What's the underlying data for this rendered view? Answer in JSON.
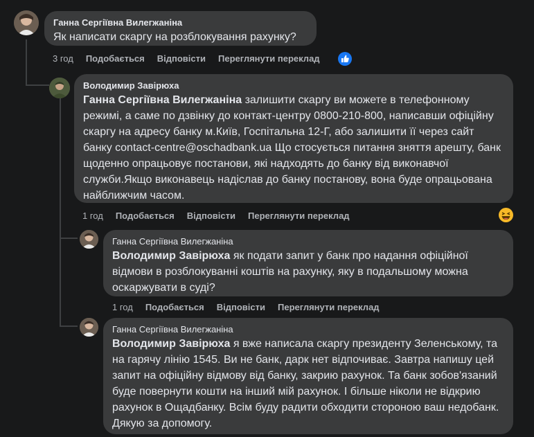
{
  "comments": [
    {
      "author": "Ганна Сергіївна Вилегжаніна",
      "mention": "",
      "text": "Як написати скаргу на розблокування рахунку?",
      "time": "3 год",
      "reaction_icon": "like-icon"
    },
    {
      "author": "Володимир Завірюха",
      "mention": "Ганна Сергіївна Вилегжаніна",
      "text": " залишити скаргу ви можете в телефонному режимі, а саме по дзвінку до контакт-центру 0800-210-800, написавши офіційну скаргу на адресу банку м.Київ, Госпітальна 12-Г, або залишити її через сайт банку contact-centre@oschadbank.ua Що стосується питання зняття арешту, банк щоденно опрацьовує постанови, які надходять до банку від виконавчої служби.Якщо виконавець надіслав до банку постанову, вона буде опрацьована найближчим часом.",
      "time": "1 год",
      "reaction_icon": "laughing-emoji-icon"
    },
    {
      "author": "Ганна Сергіївна Вилегжаніна",
      "mention": "Володимир Завірюха",
      "text": " як подати запит у банк про надання офіційної відмови в розблокуванні коштів на рахунку, яку в подальшому можна оскаржувати в суді?",
      "time": "1 год"
    },
    {
      "author": "Ганна Сергіївна Вилегжаніна",
      "mention": "Володимир Завірюха",
      "text": " я вже написала скаргу президенту Зеленському, та на гарячу лінію 1545. Ви не банк, дарк нет відпочиває. Завтра напишу цей запит на офіційну відмову від банку, закрию рахунок. Та банк зобов'язаний буде повернути кошти на інший мій рахунок. І більше ніколи не відкрию рахунок в Ощадбанку. Всім буду радити обходити стороною ваш недобанк. Дякую за допомогу."
    }
  ],
  "actions": {
    "like": "Подобається",
    "reply": "Відповісти",
    "translate": "Переглянути переклад"
  },
  "colors": {
    "background": "#18191a",
    "bubble": "#3a3b3c",
    "text": "#e4e6eb",
    "muted": "#b0b3b8",
    "like_blue": "#1877f2"
  }
}
